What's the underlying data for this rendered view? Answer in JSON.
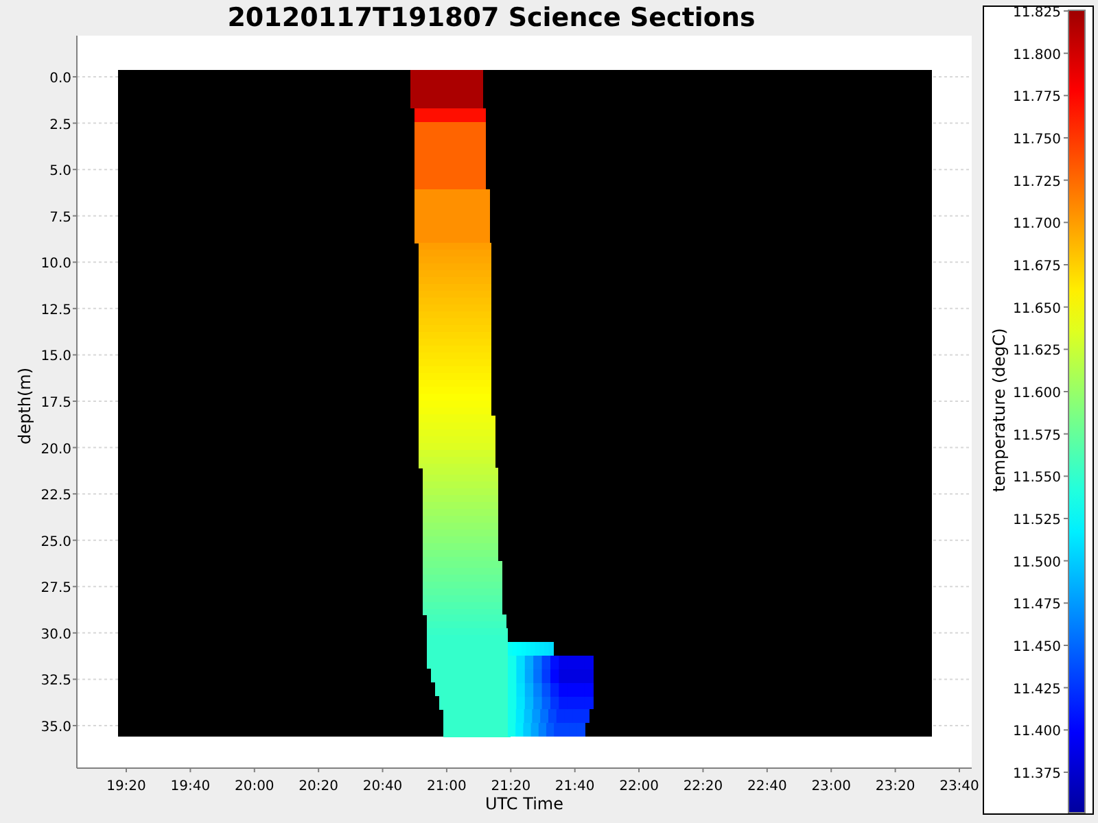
{
  "title": "20120117T191807 Science Sections",
  "y_axis": {
    "label": "depth(m)",
    "ticks": [
      "0.0",
      "2.5",
      "5.0",
      "7.5",
      "10.0",
      "12.5",
      "15.0",
      "17.5",
      "20.0",
      "22.5",
      "25.0",
      "27.5",
      "30.0",
      "32.5",
      "35.0"
    ]
  },
  "x_axis": {
    "label": "UTC Time",
    "ticks": [
      "19:20",
      "19:40",
      "20:00",
      "20:20",
      "20:40",
      "21:00",
      "21:20",
      "21:40",
      "22:00",
      "22:20",
      "22:40",
      "23:00",
      "23:20",
      "23:40"
    ]
  },
  "colorbar": {
    "label": "temperature (degC)",
    "ticks": [
      "11.825",
      "11.800",
      "11.775",
      "11.750",
      "11.725",
      "11.700",
      "11.675",
      "11.650",
      "11.625",
      "11.600",
      "11.575",
      "11.550",
      "11.525",
      "11.500",
      "11.475",
      "11.450",
      "11.425",
      "11.400",
      "11.375"
    ]
  }
}
